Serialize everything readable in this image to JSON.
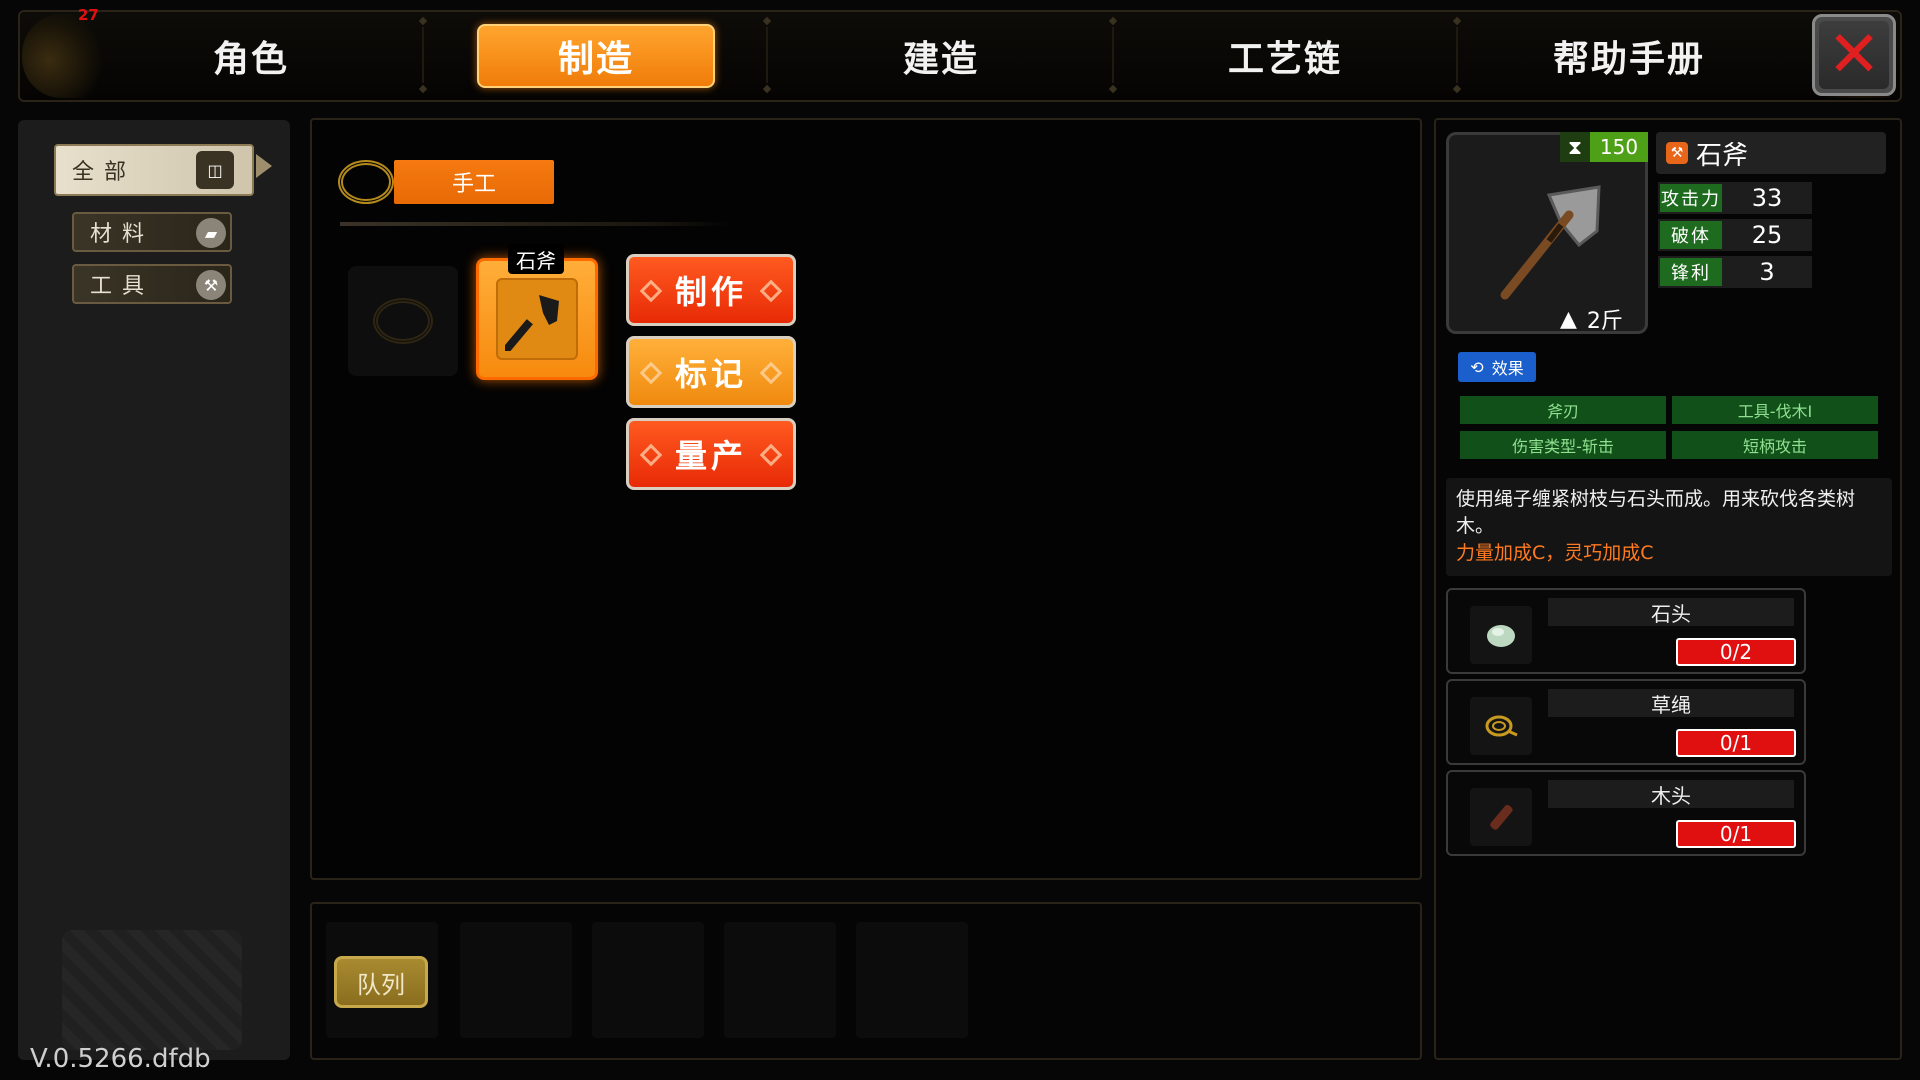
{
  "debug": {
    "fps": "27"
  },
  "nav": {
    "tabs": [
      {
        "label": "角色",
        "active": false
      },
      {
        "label": "制造",
        "active": true
      },
      {
        "label": "建造",
        "active": false
      },
      {
        "label": "工艺链",
        "active": false
      },
      {
        "label": "帮助手册",
        "active": false
      }
    ],
    "close_icon": "close-x-icon"
  },
  "sidebar": {
    "categories": [
      {
        "label": "全部",
        "icon": "all-icon",
        "active": true
      },
      {
        "label": "材料",
        "icon": "material-icon",
        "active": false
      },
      {
        "label": "工具",
        "icon": "tool-icon",
        "active": false
      }
    ],
    "version": "V.0.5266.dfdb"
  },
  "craft": {
    "group_label": "手工",
    "selected_recipe": "石斧",
    "actions": {
      "make": "制作",
      "mark": "标记",
      "mass_produce": "量产"
    }
  },
  "queue": {
    "label": "队列"
  },
  "detail": {
    "craft_time": "150",
    "weight": "2斤",
    "name": "石斧",
    "stats": [
      {
        "key": "攻击力",
        "value": "33"
      },
      {
        "key": "破体",
        "value": "25"
      },
      {
        "key": "锋利",
        "value": "3"
      }
    ],
    "effect_label": "效果",
    "effects": [
      "斧刃",
      "工具-伐木Ⅰ",
      "伤害类型-斩击",
      "短柄攻击"
    ],
    "description": "使用绳子缠紧树枝与石头而成。用来砍伐各类树木。",
    "bonus": "力量加成C，灵巧加成C",
    "materials": [
      {
        "name": "石头",
        "count": "0/2",
        "icon": "stone-icon"
      },
      {
        "name": "草绳",
        "count": "0/1",
        "icon": "rope-icon"
      },
      {
        "name": "木头",
        "count": "0/1",
        "icon": "wood-icon"
      }
    ]
  },
  "colors": {
    "accent_orange": "#f07c0a",
    "action_red": "#e82a06",
    "stat_green": "#1e6a1e",
    "effect_blue": "#1a5fcc",
    "bonus_text": "#ff7a20",
    "missing_red": "#e01010"
  }
}
